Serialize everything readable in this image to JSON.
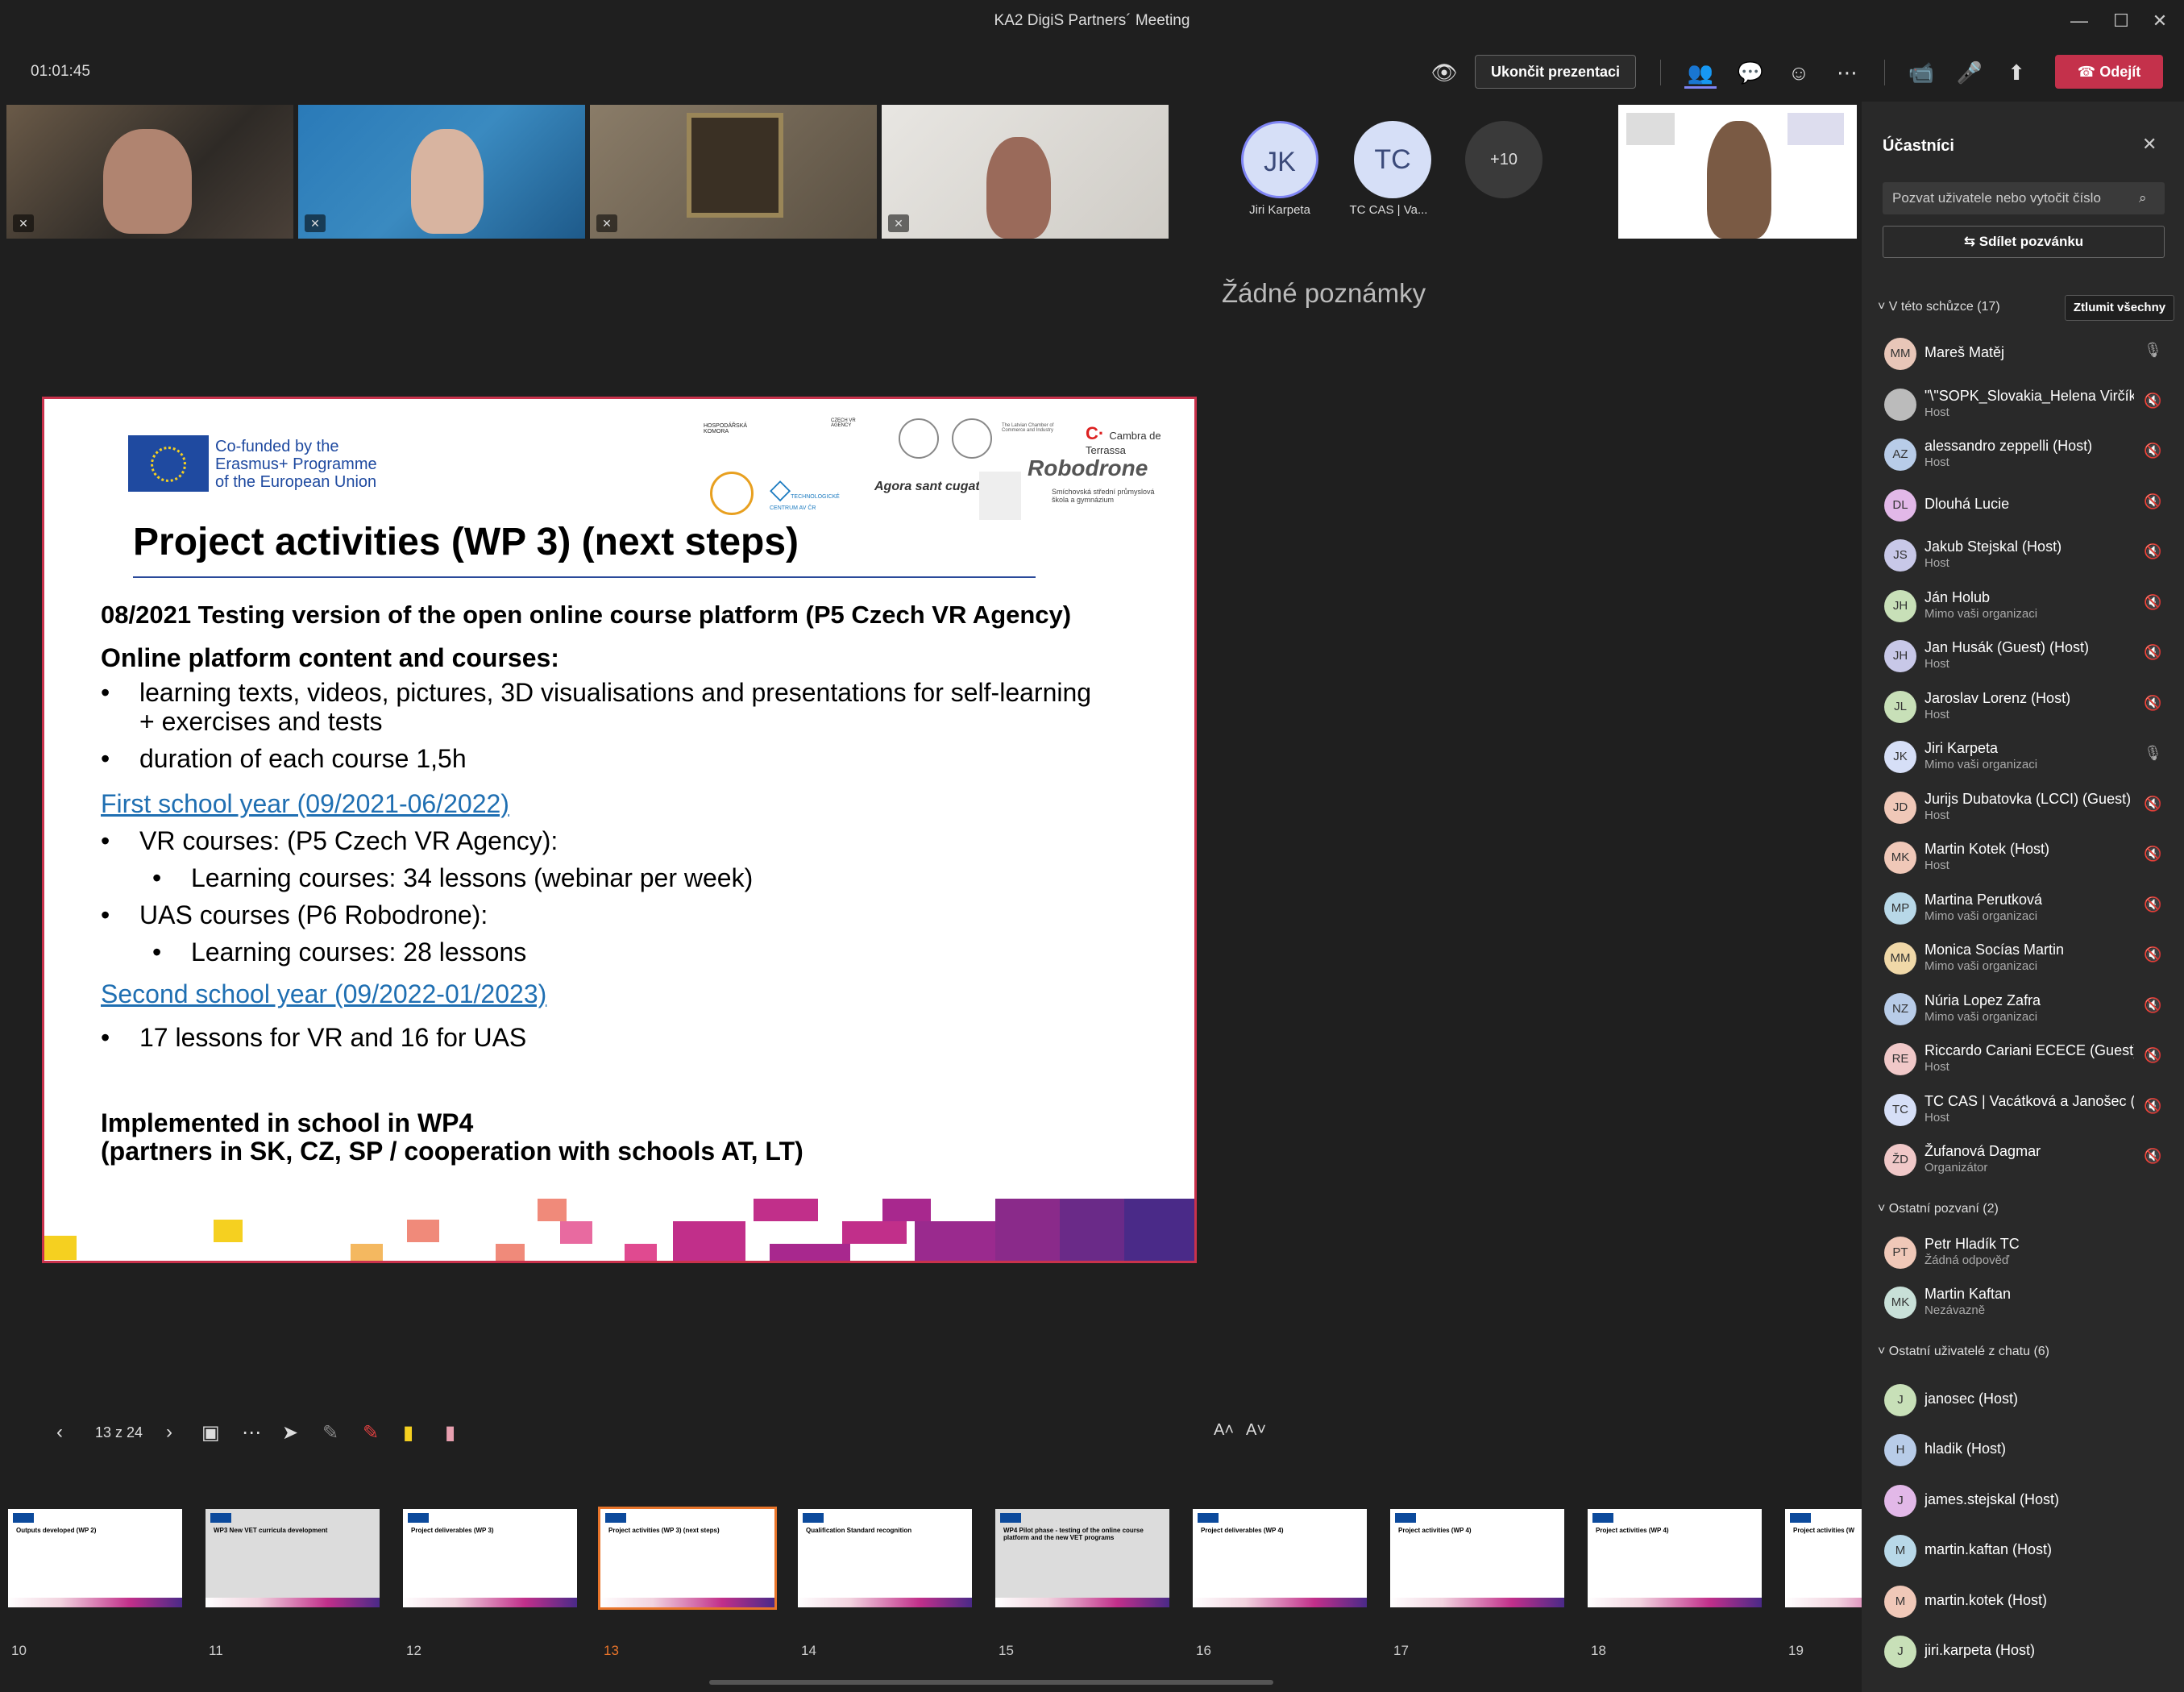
{
  "window": {
    "title": "KA2 DigiS Partners´ Meeting"
  },
  "topbar": {
    "timer": "01:01:45",
    "stop_presenting": "Ukončit prezentaci",
    "leave": "Odejít"
  },
  "participants_gallery": [
    {
      "initials": "JK",
      "name": "Jiri Karpeta"
    },
    {
      "initials": "TC",
      "name": "TC CAS | Va..."
    },
    {
      "initials": "+10"
    }
  ],
  "notes": "Žádné poznámky",
  "slide": {
    "cofunded": [
      "Co-funded by the",
      "Erasmus+ Programme",
      "of the European Union"
    ],
    "logos": [
      "HOSPODÁŘSKÁ KOMORA",
      "CZECH VR AGENCY",
      "The Latvian Chamber of Commerce and Industry",
      "Cambra de Terrassa",
      "Robodrone",
      "TECHNOLOGICKÉ CENTRUM AV ČR",
      "Agora sant cugat",
      "Smíchovská střední průmyslová škola a gymnázium"
    ],
    "title": "Project activities (WP 3) (next steps)",
    "l1": "08/2021 Testing version of the open online course platform (P5 Czech VR Agency)",
    "l2": "Online platform content and courses:",
    "b1a": "learning texts, videos, pictures, 3D visualisations and presentations for self-learning",
    "b1b": "+ exercises and tests",
    "b2": "duration of each course 1,5h",
    "link1": "First school year (09/2021-06/2022)",
    "b3": "VR courses: (P5 Czech VR Agency):",
    "b3s": "Learning courses: 34 lessons (webinar per week)",
    "b4": "UAS courses (P6 Robodrone):",
    "b4s": "Learning courses: 28 lessons",
    "link2": "Second school year (09/2022-01/2023)",
    "b5": "17 lessons for VR and 16 for UAS",
    "impl1": "Implemented in school in WP4",
    "impl2": "(partners in SK, CZ, SP / cooperation with schools AT, LT)"
  },
  "controls": {
    "page": "13 z 24",
    "font_up": "A˄",
    "font_down": "A˅"
  },
  "thumbnails": [
    {
      "num": "10",
      "title": "Outputs developed (WP 2)"
    },
    {
      "num": "11",
      "title": "WP3 New VET curricula development"
    },
    {
      "num": "12",
      "title": "Project deliverables (WP 3)"
    },
    {
      "num": "13",
      "title": "Project activities (WP 3) (next steps)"
    },
    {
      "num": "14",
      "title": "Qualification Standard recognition"
    },
    {
      "num": "15",
      "title": "WP4 Pilot phase - testing of the online course platform and the new VET programs"
    },
    {
      "num": "16",
      "title": "Project deliverables (WP 4)"
    },
    {
      "num": "17",
      "title": "Project activities (WP 4)"
    },
    {
      "num": "18",
      "title": "Project activities (WP 4)"
    },
    {
      "num": "19",
      "title": "Project activities (W"
    }
  ],
  "panel": {
    "title": "Účastníci",
    "invite_placeholder": "Pozvat uživatele nebo vytočit číslo",
    "share": "Sdílet pozvánku",
    "sec_meeting": "V této schůzce (17)",
    "mute_all": "Ztlumit všechny",
    "in_meeting": [
      {
        "initials": "MM",
        "name": "Mareš Matěj",
        "sub": "",
        "color": "#e8c6b8",
        "mic": "🎙"
      },
      {
        "initials": "",
        "name": "\"\\\"SOPK_Slovakia_Helena Virčík...",
        "sub": "Host",
        "color": "#bbbbbb",
        "mic": "🔇"
      },
      {
        "initials": "AZ",
        "name": "alessandro zeppelli (Host)",
        "sub": "Host",
        "color": "#b8cce8",
        "mic": "🔇"
      },
      {
        "initials": "DL",
        "name": "Dlouhá Lucie",
        "sub": "",
        "color": "#e2b8e8",
        "mic": "🔇"
      },
      {
        "initials": "JS",
        "name": "Jakub Stejskal (Host)",
        "sub": "Host",
        "color": "#c8c8e8",
        "mic": "🔇"
      },
      {
        "initials": "JH",
        "name": "Ján Holub",
        "sub": "Mimo vaši organizaci",
        "color": "#c8e0b8",
        "mic": "🔇"
      },
      {
        "initials": "JH",
        "name": "Jan Husák (Guest) (Host)",
        "sub": "Host",
        "color": "#c8c8e8",
        "mic": "🔇"
      },
      {
        "initials": "JL",
        "name": "Jaroslav Lorenz (Host)",
        "sub": "Host",
        "color": "#c8e0b8",
        "mic": "🔇"
      },
      {
        "initials": "JK",
        "name": "Jiri Karpeta",
        "sub": "Mimo vaši organizaci",
        "color": "#d6dff7",
        "mic": "🎙"
      },
      {
        "initials": "JD",
        "name": "Jurijs Dubatovka (LCCI) (Guest) (...",
        "sub": "Host",
        "color": "#f0c8b8",
        "mic": "🔇"
      },
      {
        "initials": "MK",
        "name": "Martin Kotek (Host)",
        "sub": "Host",
        "color": "#f0c8b8",
        "mic": "🔇"
      },
      {
        "initials": "MP",
        "name": "Martina Perutková",
        "sub": "Mimo vaši organizaci",
        "color": "#b8d8e8",
        "mic": "🔇"
      },
      {
        "initials": "MM",
        "name": "Monica Socías Martin",
        "sub": "Mimo vaši organizaci",
        "color": "#f0d8a8",
        "mic": "🔇"
      },
      {
        "initials": "NZ",
        "name": "Núria Lopez Zafra",
        "sub": "Mimo vaši organizaci",
        "color": "#b8cce8",
        "mic": "🔇"
      },
      {
        "initials": "RE",
        "name": "Riccardo Cariani ECECE (Guest) (...",
        "sub": "Host",
        "color": "#f0c8c8",
        "mic": "🔇"
      },
      {
        "initials": "TC",
        "name": "TC CAS | Vacátková a Janošec (H...",
        "sub": "Host",
        "color": "#d6dff7",
        "mic": "🔇"
      },
      {
        "initials": "ŽD",
        "name": "Žufanová Dagmar",
        "sub": "Organizátor",
        "color": "#f0c8c8",
        "mic": "🔇"
      }
    ],
    "sec_invited": "Ostatní pozvaní (2)",
    "invited": [
      {
        "initials": "PT",
        "name": "Petr Hladík TC",
        "sub": "Žádná odpověď",
        "color": "#f0c8b8"
      },
      {
        "initials": "MK",
        "name": "Martin Kaftan",
        "sub": "Nezávazně",
        "color": "#c8e0d8"
      }
    ],
    "sec_chat": "Ostatní uživatelé z chatu (6)",
    "chat": [
      {
        "initials": "J",
        "name": "janosec (Host)",
        "color": "#c8e0b8"
      },
      {
        "initials": "H",
        "name": "hladik (Host)",
        "color": "#b8cce8"
      },
      {
        "initials": "J",
        "name": "james.stejskal (Host)",
        "color": "#e2b8e8"
      },
      {
        "initials": "M",
        "name": "martin.kaftan (Host)",
        "color": "#b8d8e8"
      },
      {
        "initials": "M",
        "name": "martin.kotek (Host)",
        "color": "#f0c8b8"
      },
      {
        "initials": "J",
        "name": "jiri.karpeta (Host)",
        "color": "#c8e0b8"
      }
    ]
  },
  "colors": {
    "accent": "#6264a7",
    "leave": "#c4314b",
    "link": "#1f6fb2",
    "panel": "#292929"
  }
}
